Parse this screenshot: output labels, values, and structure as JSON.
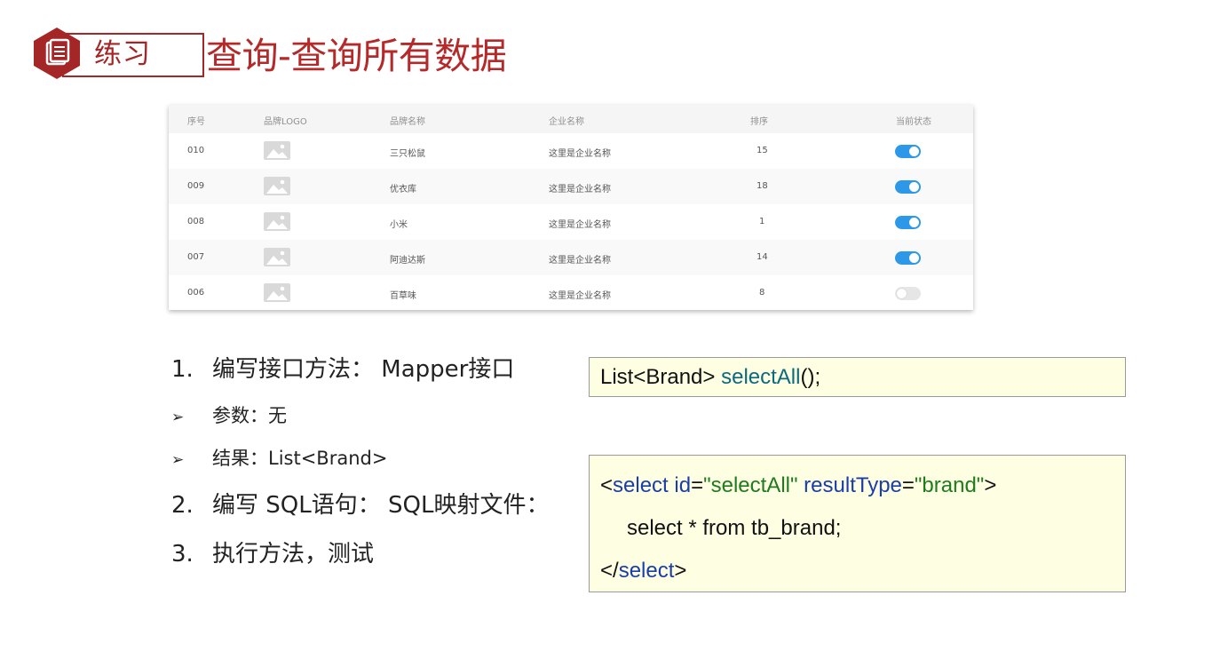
{
  "header": {
    "badge_label": "练习",
    "badge_icon": "document-icon",
    "title": "查询-查询所有数据"
  },
  "table": {
    "columns": [
      "序号",
      "品牌LOGO",
      "品牌名称",
      "企业名称",
      "排序",
      "当前状态"
    ],
    "rows": [
      {
        "id": "010",
        "brand": "三只松鼠",
        "company": "这里是企业名称",
        "order": "15",
        "status": true
      },
      {
        "id": "009",
        "brand": "优衣库",
        "company": "这里是企业名称",
        "order": "18",
        "status": true
      },
      {
        "id": "008",
        "brand": "小米",
        "company": "这里是企业名称",
        "order": "1",
        "status": true
      },
      {
        "id": "007",
        "brand": "阿迪达斯",
        "company": "这里是企业名称",
        "order": "14",
        "status": true
      },
      {
        "id": "006",
        "brand": "百草味",
        "company": "这里是企业名称",
        "order": "8",
        "status": false
      }
    ]
  },
  "steps": {
    "s1_num": "1.",
    "s1_text": "编写接口方法： Mapper接口",
    "b1_arrow": "➢",
    "b1_text": "参数：无",
    "b2_arrow": "➢",
    "b2_text": "结果：List<Brand>",
    "s2_num": "2.",
    "s2_text": "编写 SQL语句： SQL映射文件：",
    "s3_num": "3.",
    "s3_text": "执行方法，测试"
  },
  "code1": {
    "prefix": "List<Brand> ",
    "method": "selectAll",
    "suffix": "();"
  },
  "code2": {
    "l1_open": "<",
    "l1_tag": "select",
    "l1_attr1": " id",
    "l1_eq1": "=",
    "l1_val1": "\"selectAll\"",
    "l1_attr2": " resultType",
    "l1_eq2": "=",
    "l1_val2": "\"brand\"",
    "l1_close": ">",
    "l2": "select * from tb_brand;",
    "l3_open": "</",
    "l3_tag": "select",
    "l3_close": ">"
  },
  "colors": {
    "accent_red": "#a52626",
    "toggle_on": "#2d97e8",
    "code_bg": "#fefee2"
  }
}
